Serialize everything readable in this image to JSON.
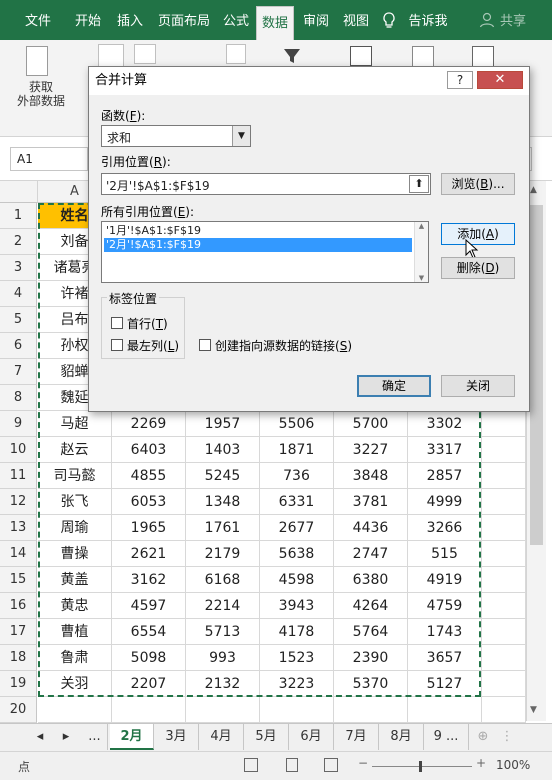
{
  "menu": {
    "tabs": [
      "文件",
      "开始",
      "插入",
      "页面布局",
      "公式",
      "数据",
      "审阅",
      "视图",
      "告诉我",
      "共享"
    ],
    "active_tab": "数据"
  },
  "ribbon": {
    "get_external_label": "获取\n外部数据"
  },
  "namebox": "A1",
  "grid": {
    "col_a": "A",
    "rows": [
      {
        "n": "1",
        "name": "姓名",
        "vals": [
          "",
          "",
          "",
          "",
          ""
        ]
      },
      {
        "n": "2",
        "name": "刘备",
        "vals": [
          "",
          "",
          "",
          "",
          ""
        ]
      },
      {
        "n": "3",
        "name": "诸葛亮",
        "vals": [
          "",
          "",
          "",
          "",
          ""
        ]
      },
      {
        "n": "4",
        "name": "许褚",
        "vals": [
          "",
          "",
          "",
          "",
          ""
        ]
      },
      {
        "n": "5",
        "name": "吕布",
        "vals": [
          "",
          "",
          "",
          "",
          ""
        ]
      },
      {
        "n": "6",
        "name": "孙权",
        "vals": [
          "",
          "",
          "",
          "",
          ""
        ]
      },
      {
        "n": "7",
        "name": "貂蝉",
        "vals": [
          "",
          "",
          "",
          "",
          ""
        ]
      },
      {
        "n": "8",
        "name": "魏延",
        "vals": [
          "",
          "",
          "",
          "",
          ""
        ]
      },
      {
        "n": "9",
        "name": "马超",
        "vals": [
          "2269",
          "1957",
          "5506",
          "5700",
          "3302"
        ]
      },
      {
        "n": "10",
        "name": "赵云",
        "vals": [
          "6403",
          "1403",
          "1871",
          "3227",
          "3317"
        ]
      },
      {
        "n": "11",
        "name": "司马懿",
        "vals": [
          "4855",
          "5245",
          "736",
          "3848",
          "2857"
        ]
      },
      {
        "n": "12",
        "name": "张飞",
        "vals": [
          "6053",
          "1348",
          "6331",
          "3781",
          "4999"
        ]
      },
      {
        "n": "13",
        "name": "周瑜",
        "vals": [
          "1965",
          "1761",
          "2677",
          "4436",
          "3266"
        ]
      },
      {
        "n": "14",
        "name": "曹操",
        "vals": [
          "2621",
          "2179",
          "5638",
          "2747",
          "515"
        ]
      },
      {
        "n": "15",
        "name": "黄盖",
        "vals": [
          "3162",
          "6168",
          "4598",
          "6380",
          "4919"
        ]
      },
      {
        "n": "16",
        "name": "黄忠",
        "vals": [
          "4597",
          "2214",
          "3943",
          "4264",
          "4759"
        ]
      },
      {
        "n": "17",
        "name": "曹植",
        "vals": [
          "6554",
          "5713",
          "4178",
          "5764",
          "1743"
        ]
      },
      {
        "n": "18",
        "name": "鲁肃",
        "vals": [
          "5098",
          "993",
          "1523",
          "2390",
          "3657"
        ]
      },
      {
        "n": "19",
        "name": "关羽",
        "vals": [
          "2207",
          "2132",
          "3223",
          "5370",
          "5127"
        ]
      },
      {
        "n": "20",
        "name": "",
        "vals": [
          "",
          "",
          "",
          "",
          ""
        ]
      }
    ]
  },
  "sheets": {
    "nav": [
      "◂",
      "▸",
      "..."
    ],
    "tabs": [
      "2月",
      "3月",
      "4月",
      "5月",
      "6月",
      "7月",
      "8月",
      "9 ..."
    ],
    "active": "2月"
  },
  "status": {
    "mode": "点",
    "zoom": "100%"
  },
  "dialog": {
    "title": "合并计算",
    "help": "?",
    "close": "✕",
    "function_label": "函数(",
    "function_key": "F",
    "function_value": "求和",
    "ref_label": "引用位置(",
    "ref_key": "R",
    "ref_value": "'2月'!$A$1:$F$19",
    "browse": "浏览(",
    "browse_key": "B",
    "all_refs_label": "所有引用位置(",
    "all_refs_key": "E",
    "all_refs": [
      "'1月'!$A$1:$F$19",
      "'2月'!$A$1:$F$19"
    ],
    "add": "添加(",
    "add_key": "A",
    "delete": "删除(",
    "delete_key": "D",
    "group_label": "标签位置",
    "top_row": "首行(",
    "top_row_key": "T",
    "left_col": "最左列(",
    "left_col_key": "L",
    "link": "创建指向源数据的链接(",
    "link_key": "S",
    "ok": "确定",
    "closebtn": "关闭"
  }
}
